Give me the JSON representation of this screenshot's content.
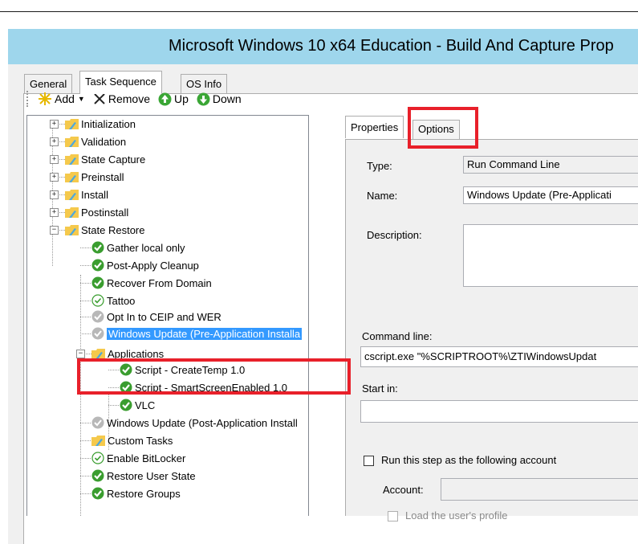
{
  "window": {
    "title": "Microsoft Windows 10 x64 Education - Build And Capture Prop"
  },
  "tabs": [
    "General",
    "Task Sequence",
    "OS Info"
  ],
  "toolbar": {
    "add": "Add",
    "remove": "Remove",
    "up": "Up",
    "down": "Down"
  },
  "tree": {
    "groups": [
      "Initialization",
      "Validation",
      "State Capture",
      "Preinstall",
      "Install",
      "Postinstall",
      "State Restore"
    ],
    "state_restore_children": {
      "gather": "Gather local only",
      "post_apply": "Post-Apply Cleanup",
      "recover": "Recover From Domain",
      "tattoo": "Tattoo",
      "optin": "Opt In to CEIP and WER",
      "wu_pre": "Windows Update (Pre-Application Installa",
      "applications": "Applications",
      "script_temp": "Script - CreateTemp 1.0",
      "script_smart": "Script - SmartScreenEnabled 1.0",
      "vlc": "VLC",
      "wu_post": "Windows Update (Post-Application Install",
      "custom": "Custom Tasks",
      "bitlocker": "Enable BitLocker",
      "restore_user": "Restore User State",
      "restore_groups": "Restore Groups"
    }
  },
  "properties": {
    "tabs": [
      "Properties",
      "Options"
    ],
    "type_label": "Type:",
    "type_value": "Run Command Line",
    "name_label": "Name:",
    "name_value": "Windows Update (Pre-Applicati",
    "description_label": "Description:",
    "description_value": "",
    "command_label": "Command line:",
    "command_value": "cscript.exe \"%SCRIPTROOT%\\ZTIWindowsUpdat",
    "startin_label": "Start in:",
    "startin_value": "",
    "runas_label": "Run this step as the following account",
    "account_label": "Account:",
    "account_value": "",
    "load_profile_label": "Load the user's profile"
  },
  "colors": {
    "titlebar": "#9ed6ec",
    "selection": "#3399ff",
    "highlight_box": "#e8202a"
  }
}
